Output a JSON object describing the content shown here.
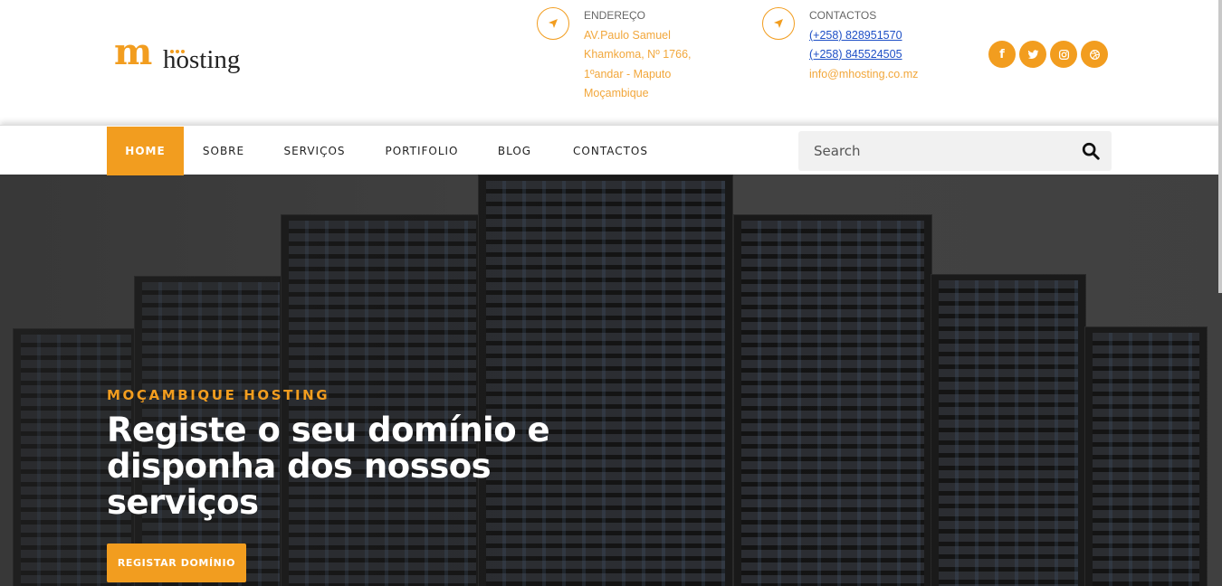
{
  "logo": {
    "mark": "m",
    "text": "hosting"
  },
  "address": {
    "title": "ENDEREÇO",
    "lines": [
      "AV.Paulo Samuel",
      "Khamkoma, Nº 1766,",
      "1ºandar - Maputo",
      "Moçambique"
    ],
    "icon": "location-arrow-icon"
  },
  "contacts": {
    "title": "CONTACTOS",
    "phones": [
      "(+258) 828951570",
      "(+258) 845524505"
    ],
    "email": "info@mhosting.co.mz",
    "icon": "location-arrow-icon"
  },
  "socials": [
    {
      "name": "facebook",
      "glyph": "f"
    },
    {
      "name": "twitter",
      "glyph": ""
    },
    {
      "name": "instagram",
      "glyph": ""
    },
    {
      "name": "dribbble",
      "glyph": ""
    }
  ],
  "nav": {
    "items": [
      "HOME",
      "SOBRE",
      "SERVIÇOS",
      "PORTIFOLIO",
      "BLOG",
      "CONTACTOS"
    ],
    "active_index": 0
  },
  "search": {
    "placeholder": "Search",
    "value": ""
  },
  "hero": {
    "subtitle": "MOÇAMBIQUE HOSTING",
    "title": "Registe o seu domínio e disponha dos nossos serviços",
    "button": "REGISTAR DOMÍNIO"
  },
  "colors": {
    "accent": "#f29d1f",
    "link": "#1d4fc6",
    "address_text": "#f2a73b"
  }
}
